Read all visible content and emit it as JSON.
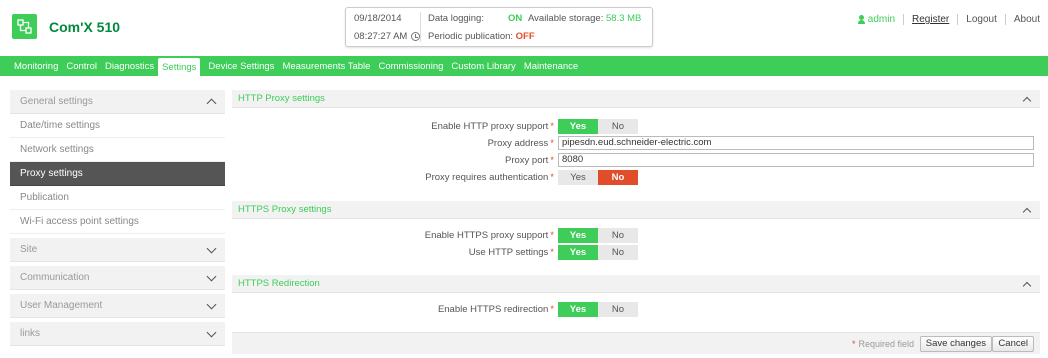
{
  "header": {
    "app_name": "Com'X 510",
    "logo_icon": "schneider-device-icon",
    "status": {
      "date": "09/18/2014",
      "time": "08:27:27 AM",
      "data_logging_label": "Data logging:",
      "data_logging_value": "ON",
      "storage_label": "Available storage:",
      "storage_value": "58.3 MB",
      "periodic_label": "Periodic publication:",
      "periodic_value": "OFF"
    },
    "user": "admin",
    "register": "Register",
    "logout": "Logout",
    "about": "About"
  },
  "nav": {
    "items": [
      "Monitoring",
      "Control",
      "Diagnostics",
      "Settings",
      "Device Settings",
      "Measurements Table",
      "Commissioning",
      "Custom Library",
      "Maintenance"
    ]
  },
  "sidebar": {
    "general": "General settings",
    "sub": [
      "Date/time settings",
      "Network settings",
      "Proxy settings",
      "Publication",
      "Wi-Fi access point settings"
    ],
    "groups": [
      "Site",
      "Communication",
      "User Management",
      "links"
    ]
  },
  "sections": {
    "http_title": "HTTP Proxy settings",
    "https_title": "HTTPS Proxy settings",
    "redirect_title": "HTTPS Redirection"
  },
  "fields": {
    "enable_http": "Enable HTTP proxy support",
    "proxy_address": "Proxy address",
    "proxy_address_value": "pipesdn.eud.schneider-electric.com",
    "proxy_port": "Proxy port",
    "proxy_port_value": "8080",
    "proxy_auth": "Proxy requires authentication",
    "enable_https": "Enable HTTPS proxy support",
    "use_http": "Use HTTP settings",
    "enable_redirect": "Enable HTTPS redirection",
    "yes": "Yes",
    "no": "No",
    "required_mark": "*"
  },
  "footer": {
    "required_note": "Required field",
    "save": "Save changes",
    "cancel": "Cancel"
  },
  "colors": {
    "brand_green": "#3dcd58",
    "off_red": "#e04d2b",
    "active_gray": "#555555"
  }
}
